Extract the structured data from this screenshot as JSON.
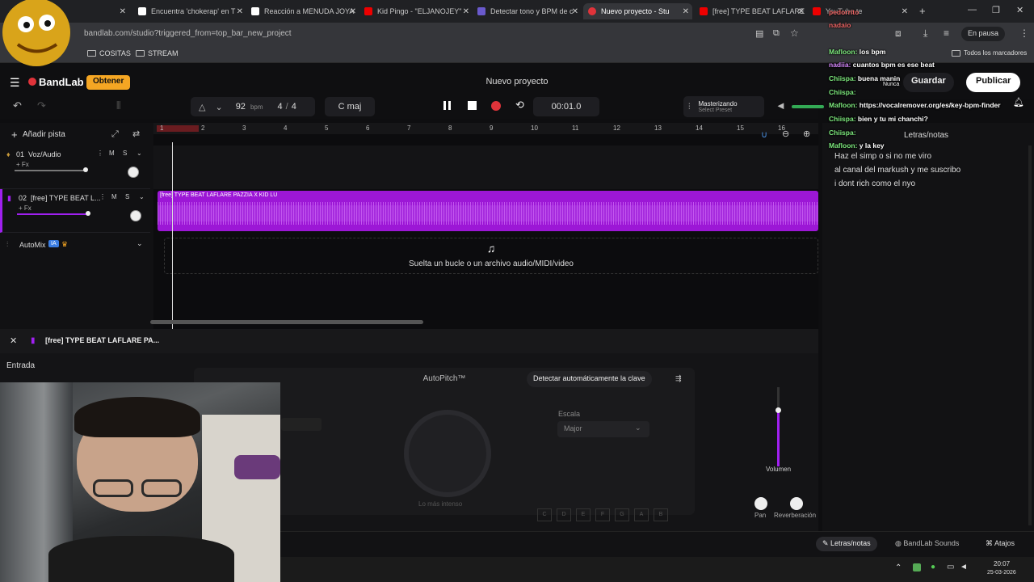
{
  "browser": {
    "tabs": [
      {
        "label": "",
        "color": "#aaa",
        "left": 0,
        "width": 160
      },
      {
        "label": "Encuentra 'chokerap' en T",
        "color": "#ffffff"
      },
      {
        "label": "Reacción a MENUDA JOYA",
        "color": "#ffffff"
      },
      {
        "label": "Kid Pingo - \"ELJANOJEY\"",
        "color": "#ff0000"
      },
      {
        "label": "Detectar tono y BPM de c",
        "color": "#6a5acd"
      },
      {
        "label": "Nuevo proyecto - Stu",
        "color": "#e0333a"
      },
      {
        "label": "[free] TYPE BEAT LAFLARE",
        "color": "#ff0000"
      },
      {
        "label": "YouTube te",
        "color": "#ff0000"
      }
    ],
    "url": "bandlab.com/studio?triggered_from=top_bar_new_project",
    "bookmarks": [
      "COSITAS",
      "STREAM"
    ],
    "all_bookmarks": "Todos los marcadores",
    "paused": "En pausa"
  },
  "app": {
    "brand": "BandLab",
    "get_button": "Obtener",
    "project_title": "Nuevo proyecto",
    "save": "Guardar",
    "publish": "Publicar",
    "bpm_value": "92",
    "bpm_unit": "bpm",
    "time_sig_num": "4",
    "time_sig_den": "4",
    "key": "C maj",
    "time": "00:01.0",
    "mastering_title": "Masterizando",
    "mastering_sub": "Select Preset",
    "add_track": "Añadir pista"
  },
  "tracks": [
    {
      "num": "01",
      "name": "Voz/Audio",
      "fx": "+ Fx",
      "color": "#9a9a9a"
    },
    {
      "num": "02",
      "name": "[free] TYPE BEAT L...",
      "fx": "+ Fx",
      "color": "#a020f0"
    }
  ],
  "automix": {
    "label": "AutoMix",
    "badge": "IA"
  },
  "ruler_numbers": [
    "1",
    "2",
    "3",
    "4",
    "5",
    "6",
    "7",
    "8",
    "9",
    "10",
    "11",
    "12",
    "13",
    "14",
    "15",
    "16"
  ],
  "clip": {
    "title": "[free] TYPE BEAT LAFLARE PAZZIA X KID LU",
    "color": "#9c17d6"
  },
  "drop_text": "Suelta un bucle o un archivo audio/MIDI/video",
  "chat": [
    {
      "name": "",
      "text": "pedorrito"
    },
    {
      "name": "",
      "text": "nadaio"
    },
    {
      "name": "Mafloon:",
      "text": "los bpm"
    },
    {
      "name": "nadiia:",
      "text": "cuantos bpm es ese beat"
    },
    {
      "name": "Chiispa:",
      "text": "buena manin"
    },
    {
      "name": "Chiispa:",
      "text": ""
    },
    {
      "name": "Mafloon:",
      "text": "https://vocalremover.org/es/key-bpm-finder"
    },
    {
      "name": "Chiispa:",
      "text": "bien y tu mi chanchi?"
    },
    {
      "name": "Chiispa:",
      "text": ""
    },
    {
      "name": "Mafloon:",
      "text": "y la key"
    }
  ],
  "chat_never": "Nunca",
  "lyrics": {
    "title": "Letras/notas",
    "lines": [
      "Haz el simp o si no me viro",
      "al canal del markush y me suscribo",
      "i dont rich como el nyo"
    ]
  },
  "bottom": {
    "track_title": "[free] TYPE BEAT LAFLARE PA...",
    "input_label": "Entrada",
    "autopitch": "AutoPitch™",
    "detect_key": "Detectar automáticamente la clave",
    "scale_label": "Escala",
    "scale_value": "Major",
    "intensity": "Lo más intenso",
    "keys": [
      "C",
      "D",
      "E",
      "F",
      "G",
      "A",
      "B"
    ],
    "volume": "Volumen",
    "pan": "Pan",
    "reverb": "Reverberación"
  },
  "status": {
    "lyrics": "Letras/notas",
    "sounds": "BandLab Sounds",
    "shortcuts": "Atajos"
  },
  "taskbar": {
    "time": "20:07",
    "date": "25-03-2026"
  }
}
